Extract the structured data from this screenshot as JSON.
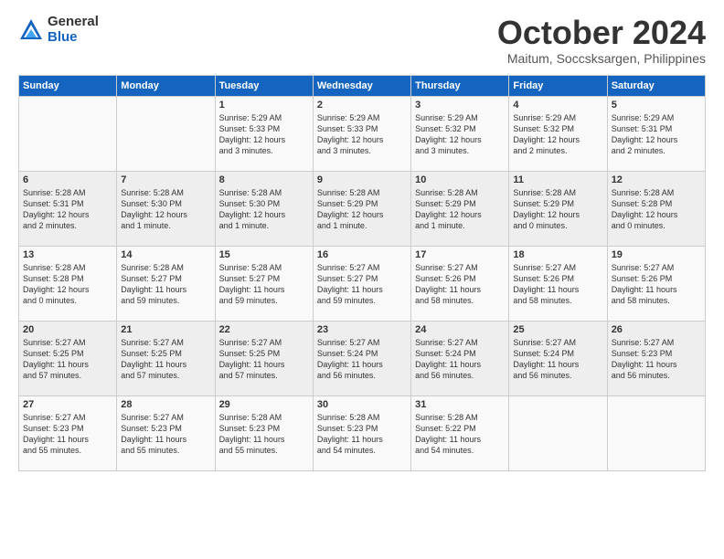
{
  "logo": {
    "general": "General",
    "blue": "Blue"
  },
  "title": "October 2024",
  "subtitle": "Maitum, Soccsksargen, Philippines",
  "weekdays": [
    "Sunday",
    "Monday",
    "Tuesday",
    "Wednesday",
    "Thursday",
    "Friday",
    "Saturday"
  ],
  "weeks": [
    [
      {
        "day": "",
        "info": ""
      },
      {
        "day": "",
        "info": ""
      },
      {
        "day": "1",
        "info": "Sunrise: 5:29 AM\nSunset: 5:33 PM\nDaylight: 12 hours\nand 3 minutes."
      },
      {
        "day": "2",
        "info": "Sunrise: 5:29 AM\nSunset: 5:33 PM\nDaylight: 12 hours\nand 3 minutes."
      },
      {
        "day": "3",
        "info": "Sunrise: 5:29 AM\nSunset: 5:32 PM\nDaylight: 12 hours\nand 3 minutes."
      },
      {
        "day": "4",
        "info": "Sunrise: 5:29 AM\nSunset: 5:32 PM\nDaylight: 12 hours\nand 2 minutes."
      },
      {
        "day": "5",
        "info": "Sunrise: 5:29 AM\nSunset: 5:31 PM\nDaylight: 12 hours\nand 2 minutes."
      }
    ],
    [
      {
        "day": "6",
        "info": "Sunrise: 5:28 AM\nSunset: 5:31 PM\nDaylight: 12 hours\nand 2 minutes."
      },
      {
        "day": "7",
        "info": "Sunrise: 5:28 AM\nSunset: 5:30 PM\nDaylight: 12 hours\nand 1 minute."
      },
      {
        "day": "8",
        "info": "Sunrise: 5:28 AM\nSunset: 5:30 PM\nDaylight: 12 hours\nand 1 minute."
      },
      {
        "day": "9",
        "info": "Sunrise: 5:28 AM\nSunset: 5:29 PM\nDaylight: 12 hours\nand 1 minute."
      },
      {
        "day": "10",
        "info": "Sunrise: 5:28 AM\nSunset: 5:29 PM\nDaylight: 12 hours\nand 1 minute."
      },
      {
        "day": "11",
        "info": "Sunrise: 5:28 AM\nSunset: 5:29 PM\nDaylight: 12 hours\nand 0 minutes."
      },
      {
        "day": "12",
        "info": "Sunrise: 5:28 AM\nSunset: 5:28 PM\nDaylight: 12 hours\nand 0 minutes."
      }
    ],
    [
      {
        "day": "13",
        "info": "Sunrise: 5:28 AM\nSunset: 5:28 PM\nDaylight: 12 hours\nand 0 minutes."
      },
      {
        "day": "14",
        "info": "Sunrise: 5:28 AM\nSunset: 5:27 PM\nDaylight: 11 hours\nand 59 minutes."
      },
      {
        "day": "15",
        "info": "Sunrise: 5:28 AM\nSunset: 5:27 PM\nDaylight: 11 hours\nand 59 minutes."
      },
      {
        "day": "16",
        "info": "Sunrise: 5:27 AM\nSunset: 5:27 PM\nDaylight: 11 hours\nand 59 minutes."
      },
      {
        "day": "17",
        "info": "Sunrise: 5:27 AM\nSunset: 5:26 PM\nDaylight: 11 hours\nand 58 minutes."
      },
      {
        "day": "18",
        "info": "Sunrise: 5:27 AM\nSunset: 5:26 PM\nDaylight: 11 hours\nand 58 minutes."
      },
      {
        "day": "19",
        "info": "Sunrise: 5:27 AM\nSunset: 5:26 PM\nDaylight: 11 hours\nand 58 minutes."
      }
    ],
    [
      {
        "day": "20",
        "info": "Sunrise: 5:27 AM\nSunset: 5:25 PM\nDaylight: 11 hours\nand 57 minutes."
      },
      {
        "day": "21",
        "info": "Sunrise: 5:27 AM\nSunset: 5:25 PM\nDaylight: 11 hours\nand 57 minutes."
      },
      {
        "day": "22",
        "info": "Sunrise: 5:27 AM\nSunset: 5:25 PM\nDaylight: 11 hours\nand 57 minutes."
      },
      {
        "day": "23",
        "info": "Sunrise: 5:27 AM\nSunset: 5:24 PM\nDaylight: 11 hours\nand 56 minutes."
      },
      {
        "day": "24",
        "info": "Sunrise: 5:27 AM\nSunset: 5:24 PM\nDaylight: 11 hours\nand 56 minutes."
      },
      {
        "day": "25",
        "info": "Sunrise: 5:27 AM\nSunset: 5:24 PM\nDaylight: 11 hours\nand 56 minutes."
      },
      {
        "day": "26",
        "info": "Sunrise: 5:27 AM\nSunset: 5:23 PM\nDaylight: 11 hours\nand 56 minutes."
      }
    ],
    [
      {
        "day": "27",
        "info": "Sunrise: 5:27 AM\nSunset: 5:23 PM\nDaylight: 11 hours\nand 55 minutes."
      },
      {
        "day": "28",
        "info": "Sunrise: 5:27 AM\nSunset: 5:23 PM\nDaylight: 11 hours\nand 55 minutes."
      },
      {
        "day": "29",
        "info": "Sunrise: 5:28 AM\nSunset: 5:23 PM\nDaylight: 11 hours\nand 55 minutes."
      },
      {
        "day": "30",
        "info": "Sunrise: 5:28 AM\nSunset: 5:23 PM\nDaylight: 11 hours\nand 54 minutes."
      },
      {
        "day": "31",
        "info": "Sunrise: 5:28 AM\nSunset: 5:22 PM\nDaylight: 11 hours\nand 54 minutes."
      },
      {
        "day": "",
        "info": ""
      },
      {
        "day": "",
        "info": ""
      }
    ]
  ]
}
